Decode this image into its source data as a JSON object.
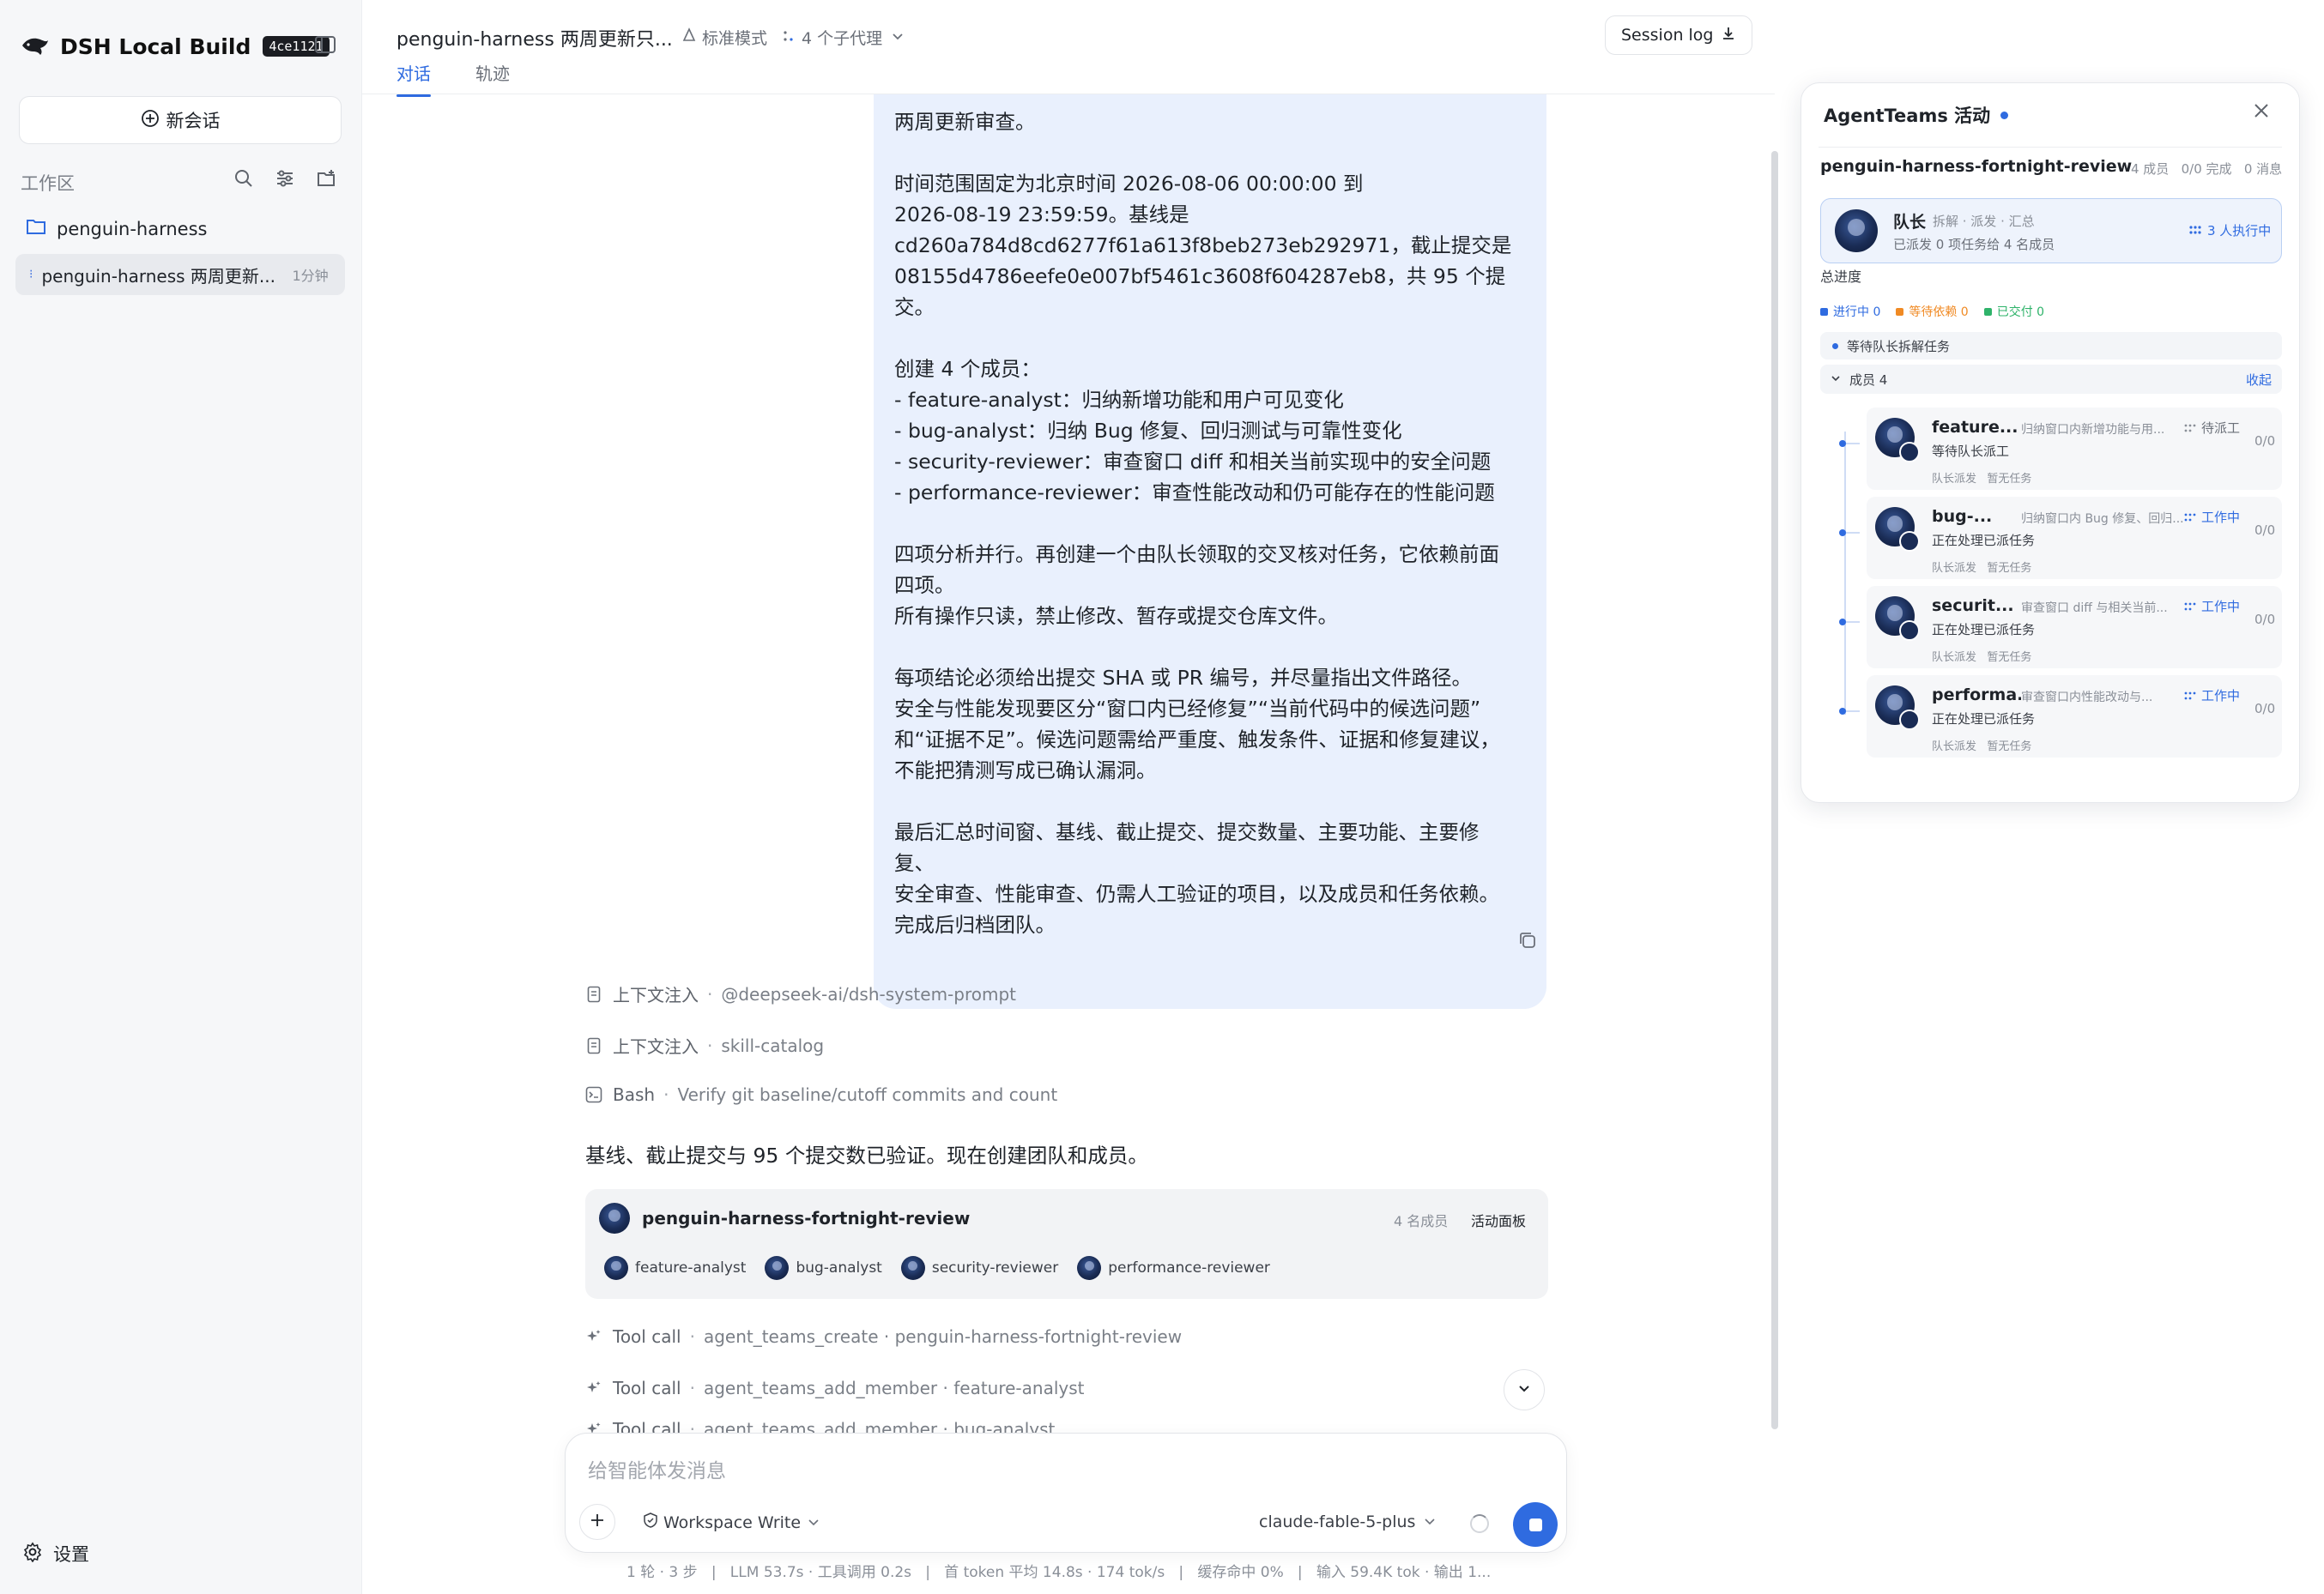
{
  "app": {
    "name": "DSH Local Build",
    "build": "4ce1121"
  },
  "sidebar": {
    "new_chat": "新会话",
    "workspace_label": "工作区",
    "folder": "penguin-harness",
    "session": {
      "title": "penguin-harness 两周更新...",
      "time": "1分钟"
    },
    "settings": "设置"
  },
  "header": {
    "title": "penguin-harness 两周更新只...",
    "mode": "标准模式",
    "agents": "4 个子代理",
    "session_log": "Session log",
    "tabs": [
      "对话",
      "轨迹"
    ]
  },
  "chat": {
    "user_message": "两周更新审查。\n\n时间范围固定为北京时间 2026-08-06 00:00:00 到\n2026-08-19 23:59:59。基线是\ncd260a784d8cd6277f61a613f8beb273eb292971，截止提交是\n08155d4786eefe0e007bf5461c3608f604287eb8，共 95 个提交。\n\n创建 4 个成员：\n- feature-analyst：归纳新增功能和用户可见变化\n- bug-analyst：归纳 Bug 修复、回归测试与可靠性变化\n- security-reviewer：审查窗口 diff 和相关当前实现中的安全问题\n- performance-reviewer：审查性能改动和仍可能存在的性能问题\n\n四项分析并行。再创建一个由队长领取的交叉核对任务，它依赖前面\n四项。\n所有操作只读，禁止修改、暂存或提交仓库文件。\n\n每项结论必须给出提交 SHA 或 PR 编号，并尽量指出文件路径。\n安全与性能发现要区分“窗口内已经修复”“当前代码中的候选问题”\n和“证据不足”。候选问题需给严重度、触发条件、证据和修复建议，\n不能把猜测写成已确认漏洞。\n\n最后汇总时间窗、基线、截止提交、提交数量、主要功能、主要修\n复、\n安全审查、性能审查、仍需人工验证的项目，以及成员和任务依赖。\n完成后归档团队。",
    "steps": [
      {
        "kind": "上下文注入",
        "detail": "@deepseek-ai/dsh-system-prompt",
        "icon": "doc-icon"
      },
      {
        "kind": "上下文注入",
        "detail": "skill-catalog",
        "icon": "doc-icon"
      },
      {
        "kind": "Bash",
        "detail": "Verify git baseline/cutoff commits and count",
        "icon": "terminal-icon"
      }
    ],
    "answer": "基线、截止提交与 95 个提交数已验证。现在创建团队和成员。",
    "team_card": {
      "name": "penguin-harness-fortnight-review",
      "count": "4 名成员",
      "panel_link": "活动面板",
      "members": [
        "feature-analyst",
        "bug-analyst",
        "security-reviewer",
        "performance-reviewer"
      ]
    },
    "tool_calls": [
      {
        "kind": "Tool call",
        "detail": "agent_teams_create · penguin-harness-fortnight-review"
      },
      {
        "kind": "Tool call",
        "detail": "agent_teams_add_member · feature-analyst"
      },
      {
        "kind": "Tool call",
        "detail": "agent_teams_add_member · bug-analyst"
      }
    ]
  },
  "composer": {
    "placeholder": "给智能体发消息",
    "permission": "Workspace Write",
    "model": "claude-fable-5-plus"
  },
  "statusbar": "1 轮 · 3 步   |   LLM 53.7s · 工具调用 0.2s   |   首 token 平均 14.8s · 174 tok/s   |   缓存命中 0%   |   输入 59.4K tok · 输出 1...",
  "panel": {
    "title": "AgentTeams 活动",
    "team": "penguin-harness-fortnight-review",
    "team_meta": "4 成员   0/0 完成   0 消息",
    "leader": {
      "name": "队长",
      "tags": "拆解 · 派发 · 汇总",
      "sub": "已派发 0 项任务给 4 名成员",
      "running": "3 人执行中"
    },
    "progress_label": "总进度",
    "legend": [
      {
        "label": "进行中 0",
        "color": "#2f6be0"
      },
      {
        "label": "等待依赖 0",
        "color": "#f08a24"
      },
      {
        "label": "已交付 0",
        "color": "#2fb36a"
      }
    ],
    "waiting": "等待队长拆解任务",
    "members_header": "成员 4",
    "collapse": "收起",
    "members": [
      {
        "name": "feature...",
        "desc": "归纳窗口内新增功能与用...",
        "status": "待派工",
        "status_color": "#6b7079",
        "sub": "等待队长派工",
        "count": "0/0",
        "foot": "队长派发   暂无任务"
      },
      {
        "name": "bug-...",
        "desc": "归纳窗口内 Bug 修复、回归...",
        "status": "工作中",
        "status_color": "#2f6be0",
        "sub": "正在处理已派任务",
        "count": "0/0",
        "foot": "队长派发   暂无任务"
      },
      {
        "name": "securit...",
        "desc": "审查窗口 diff 与相关当前...",
        "status": "工作中",
        "status_color": "#2f6be0",
        "sub": "正在处理已派任务",
        "count": "0/0",
        "foot": "队长派发   暂无任务"
      },
      {
        "name": "performa...",
        "desc": "审查窗口内性能改动与...",
        "status": "工作中",
        "status_color": "#2f6be0",
        "sub": "正在处理已派任务",
        "count": "0/0",
        "foot": "队长派发   暂无任务"
      }
    ]
  }
}
